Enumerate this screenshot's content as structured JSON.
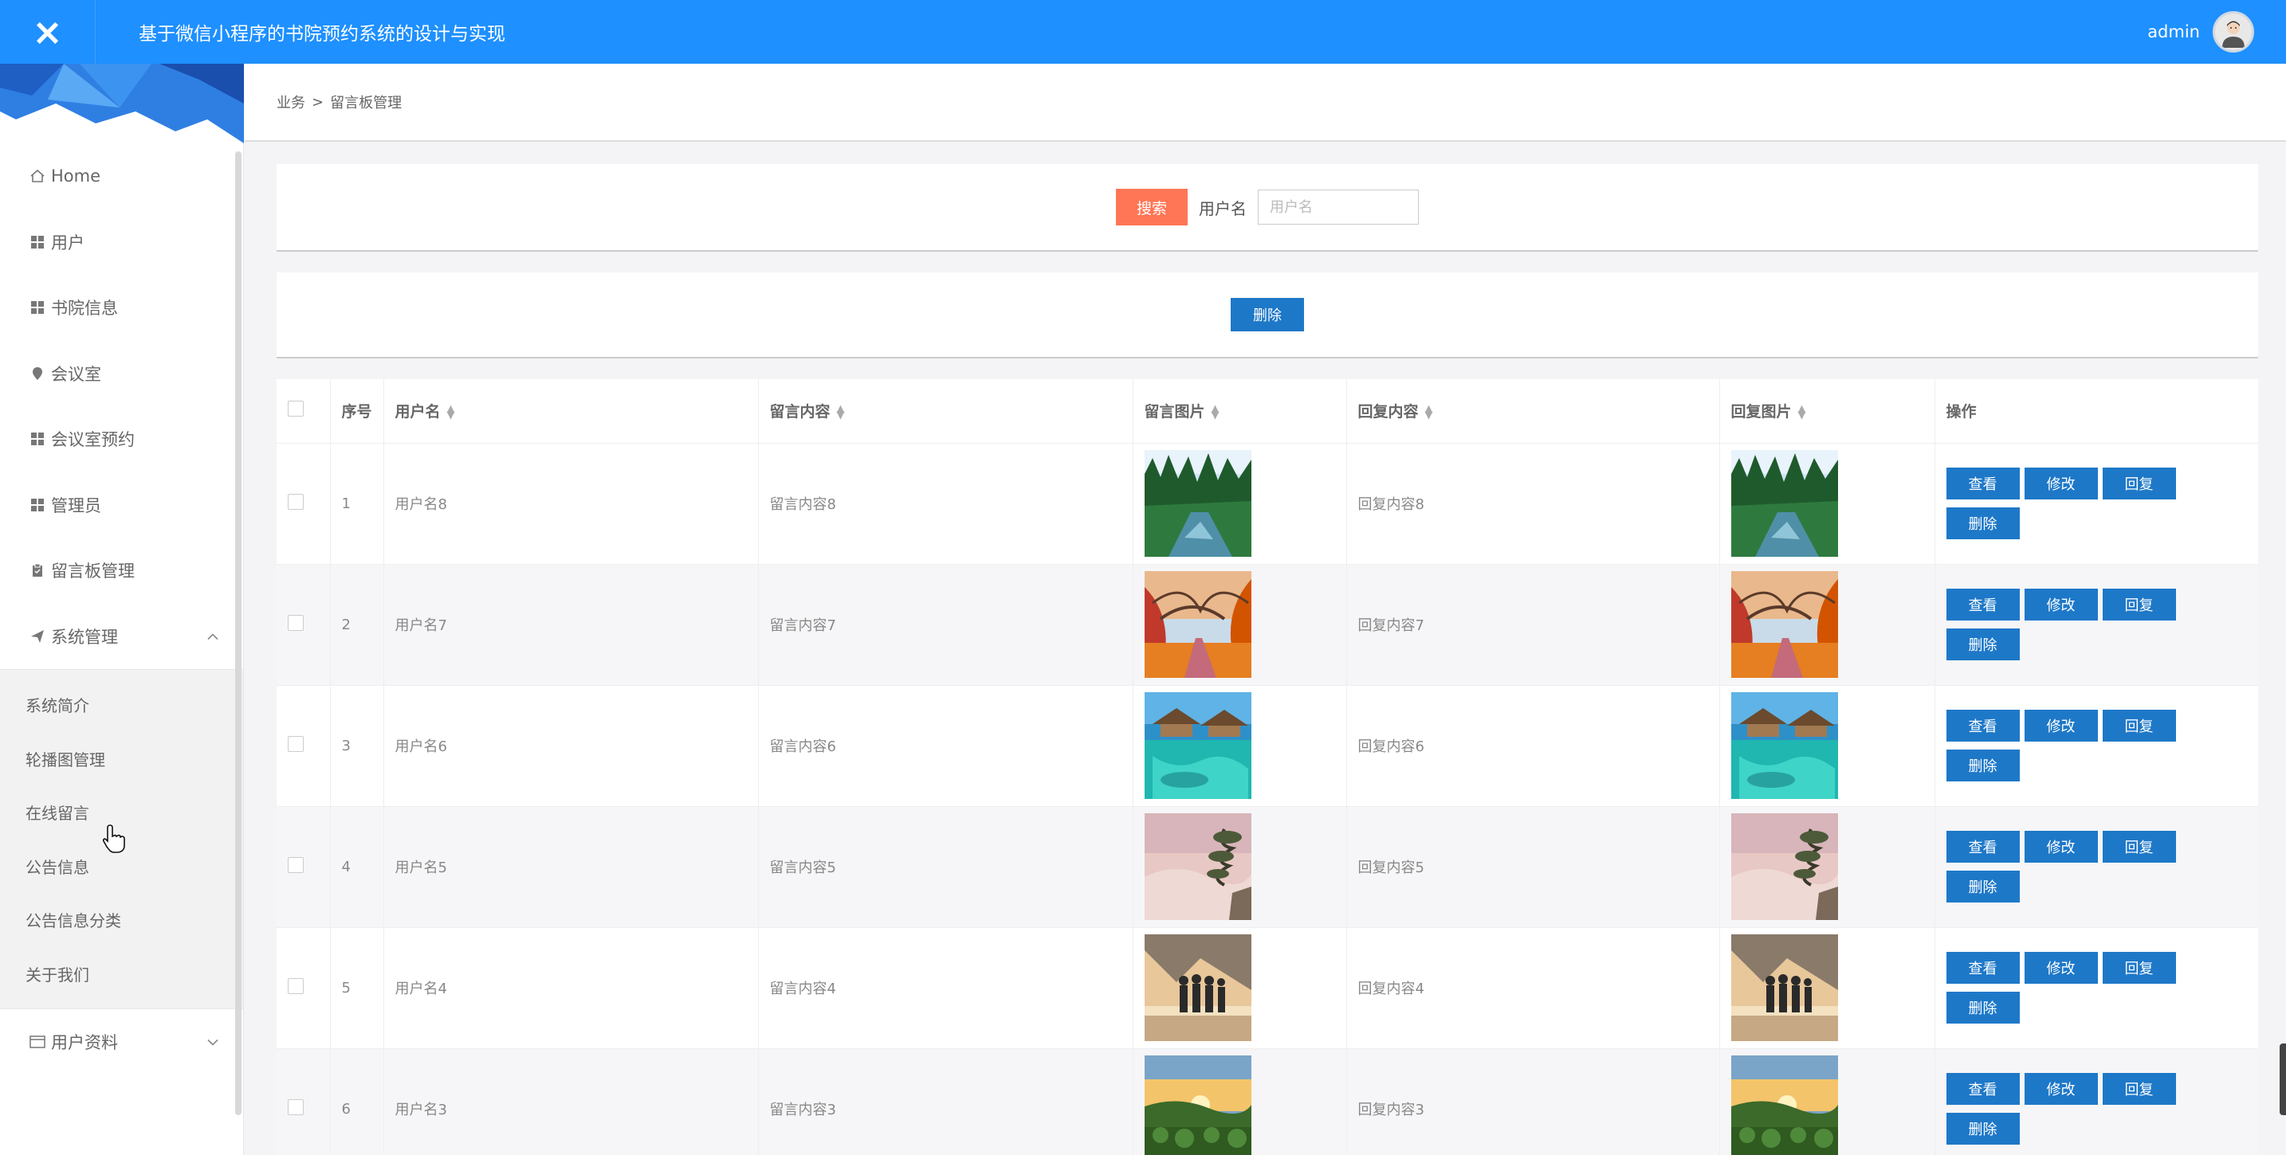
{
  "header": {
    "close_icon": "×",
    "title": "基于微信小程序的书院预约系统的设计与实现",
    "admin_name": "admin",
    "background_color": "#1e90ff"
  },
  "sidebar": {
    "items": [
      {
        "label": "Home",
        "icon": "home-icon"
      },
      {
        "label": "用户",
        "icon": "grid-icon"
      },
      {
        "label": "书院信息",
        "icon": "grid-icon"
      },
      {
        "label": "会议室",
        "icon": "pin-icon"
      },
      {
        "label": "会议室预约",
        "icon": "grid-icon"
      },
      {
        "label": "管理员",
        "icon": "grid-icon"
      },
      {
        "label": "留言板管理",
        "icon": "clipboard-icon"
      },
      {
        "label": "系统管理",
        "icon": "send-icon",
        "expanded": true
      }
    ],
    "submenu": [
      "系统简介",
      "轮播图管理",
      "在线留言",
      "公告信息",
      "公告信息分类",
      "关于我们"
    ],
    "footer_item": {
      "label": "用户资料",
      "icon": "card-icon"
    }
  },
  "breadcrumb": {
    "parent": "业务",
    "separator": ">",
    "current": "留言板管理"
  },
  "search": {
    "button_label": "搜索",
    "field_label": "用户名",
    "placeholder": "用户名",
    "button_color": "#ff7656"
  },
  "actions": {
    "delete_label": "删除",
    "button_color": "#1e78c8"
  },
  "table": {
    "headers": {
      "index": "序号",
      "username": "用户名",
      "content": "留言内容",
      "image": "留言图片",
      "reply": "回复内容",
      "reply_image": "回复图片",
      "ops": "操作"
    },
    "op_labels": {
      "view": "查看",
      "edit": "修改",
      "reply": "回复",
      "delete": "删除"
    },
    "rows": [
      {
        "index": "1",
        "username": "用户名8",
        "content": "留言内容8",
        "reply": "回复内容8",
        "image": "forest-river-image"
      },
      {
        "index": "2",
        "username": "用户名7",
        "content": "留言内容7",
        "reply": "回复内容7",
        "image": "autumn-path-image"
      },
      {
        "index": "3",
        "username": "用户名6",
        "content": "留言内容6",
        "reply": "回复内容6",
        "image": "tropical-water-image"
      },
      {
        "index": "4",
        "username": "用户名5",
        "content": "留言内容5",
        "reply": "回复内容5",
        "image": "misty-pine-image"
      },
      {
        "index": "5",
        "username": "用户名4",
        "content": "留言内容4",
        "reply": "回复内容4",
        "image": "people-lake-image"
      },
      {
        "index": "6",
        "username": "用户名3",
        "content": "留言内容3",
        "reply": "回复内容3",
        "image": "sunset-field-image"
      }
    ]
  }
}
